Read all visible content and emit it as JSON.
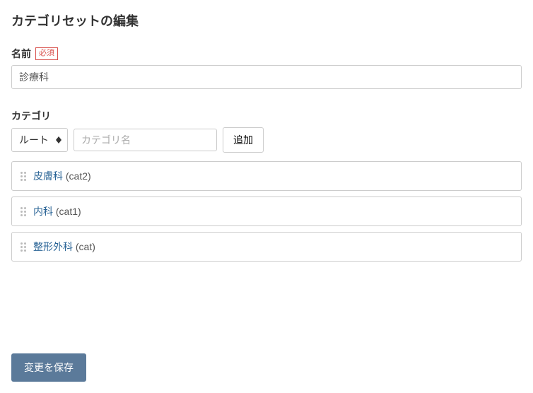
{
  "page_title": "カテゴリセットの編集",
  "name_section": {
    "label": "名前",
    "required_badge": "必須",
    "value": "診療科"
  },
  "category_section": {
    "label": "カテゴリ",
    "root_select": "ルート",
    "name_placeholder": "カテゴリ名",
    "add_button": "追加",
    "items": [
      {
        "name": "皮膚科",
        "suffix": " (cat2)"
      },
      {
        "name": "内科",
        "suffix": " (cat1)"
      },
      {
        "name": "整形外科",
        "suffix": " (cat)"
      }
    ]
  },
  "save_button": "変更を保存"
}
